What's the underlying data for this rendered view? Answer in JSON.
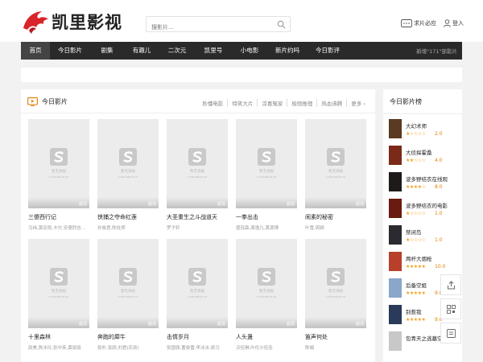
{
  "site": {
    "logo_text": "凯里影视",
    "search_placeholder": "搜影片...",
    "feedback_label": "求片必应",
    "login_label": "登入"
  },
  "nav": {
    "items": [
      "首页",
      "今日影片",
      "剧集",
      "有趣儿",
      "二次元",
      "凯里号",
      "小电影",
      "新片约吗",
      "今日影评"
    ],
    "active_index": 0,
    "notice": "新增\"171\"部影片"
  },
  "main": {
    "title": "今日影片",
    "tabs": [
      "秒懂电影",
      "特笑大片",
      "凉喜冤家",
      "极限推理",
      "热血沸腾",
      "更多 ›"
    ],
    "placeholder_caption": "暂无海报",
    "placeholder_sub": "s.zhuobuv.cn",
    "movies": [
      {
        "title": "三傻西行记",
        "actors": "马纬,黄宏雨,卡尔,安德烈吉...",
        "badge": "超清"
      },
      {
        "title": "侠捕之夺命红莲",
        "actors": "孙俊君,陈柱郑",
        "badge": "超清"
      },
      {
        "title": "大圣重生之斗战道天",
        "actors": "罗子轩",
        "badge": "超清"
      },
      {
        "title": "一拳出击",
        "actors": "盛冠森,周逸凡,黄源博",
        "badge": "超清"
      },
      {
        "title": "闹素的秘密",
        "actors": "叶雪,周颖",
        "badge": "超清"
      },
      {
        "title": "十里森林",
        "actors": "辰美,陈冰玲,张中英,黄丽丽",
        "badge": "超清"
      },
      {
        "title": "奔跑的犀牛",
        "actors": "张朴,张颜,刘君(庆辰)",
        "badge": "超清"
      },
      {
        "title": "击情岁月",
        "actors": "张国强,董俊雷,李冰冰,原马",
        "badge": "超清"
      },
      {
        "title": "人头蛊",
        "actors": "沃佳琳,叶伦沙伍佳",
        "badge": "超清"
      },
      {
        "title": "笛声何处",
        "actors": "陈娟",
        "badge": "超清"
      }
    ]
  },
  "sidebar": {
    "title": "今日影片榜",
    "items": [
      {
        "name": "大幻术师",
        "score": "2.0",
        "stars": 1,
        "color": "#5a3a22"
      },
      {
        "name": "大侦探霍桑",
        "score": "4.0",
        "stars": 2,
        "color": "#7a2a18"
      },
      {
        "name": "波多野结衣在线观",
        "score": "8.0",
        "stars": 4,
        "color": "#1e1a1a"
      },
      {
        "name": "波多野结衣的电影",
        "score": "1.0",
        "stars": 1,
        "color": "#6a1a10"
      },
      {
        "name": "禁闭岛",
        "score": "1.0",
        "stars": 1,
        "color": "#2a2a30"
      },
      {
        "name": "两杆大烟枪",
        "score": "10.0",
        "stars": 5,
        "color": "#b8402a"
      },
      {
        "name": "后备空姐",
        "score": "9.0",
        "stars": 5,
        "color": "#8aa6c8"
      },
      {
        "name": "别惹我",
        "score": "9.0",
        "stars": 5,
        "color": "#2a3a5a"
      },
      {
        "name": "包青天之逃墓空",
        "score": "",
        "stars": 0,
        "color": "#c8c8c8"
      }
    ]
  },
  "colors": {
    "nav_bg": "#2a2a2a",
    "nav_active": "#444444",
    "star": "#f0a020",
    "logo_red": "#d8242a"
  }
}
